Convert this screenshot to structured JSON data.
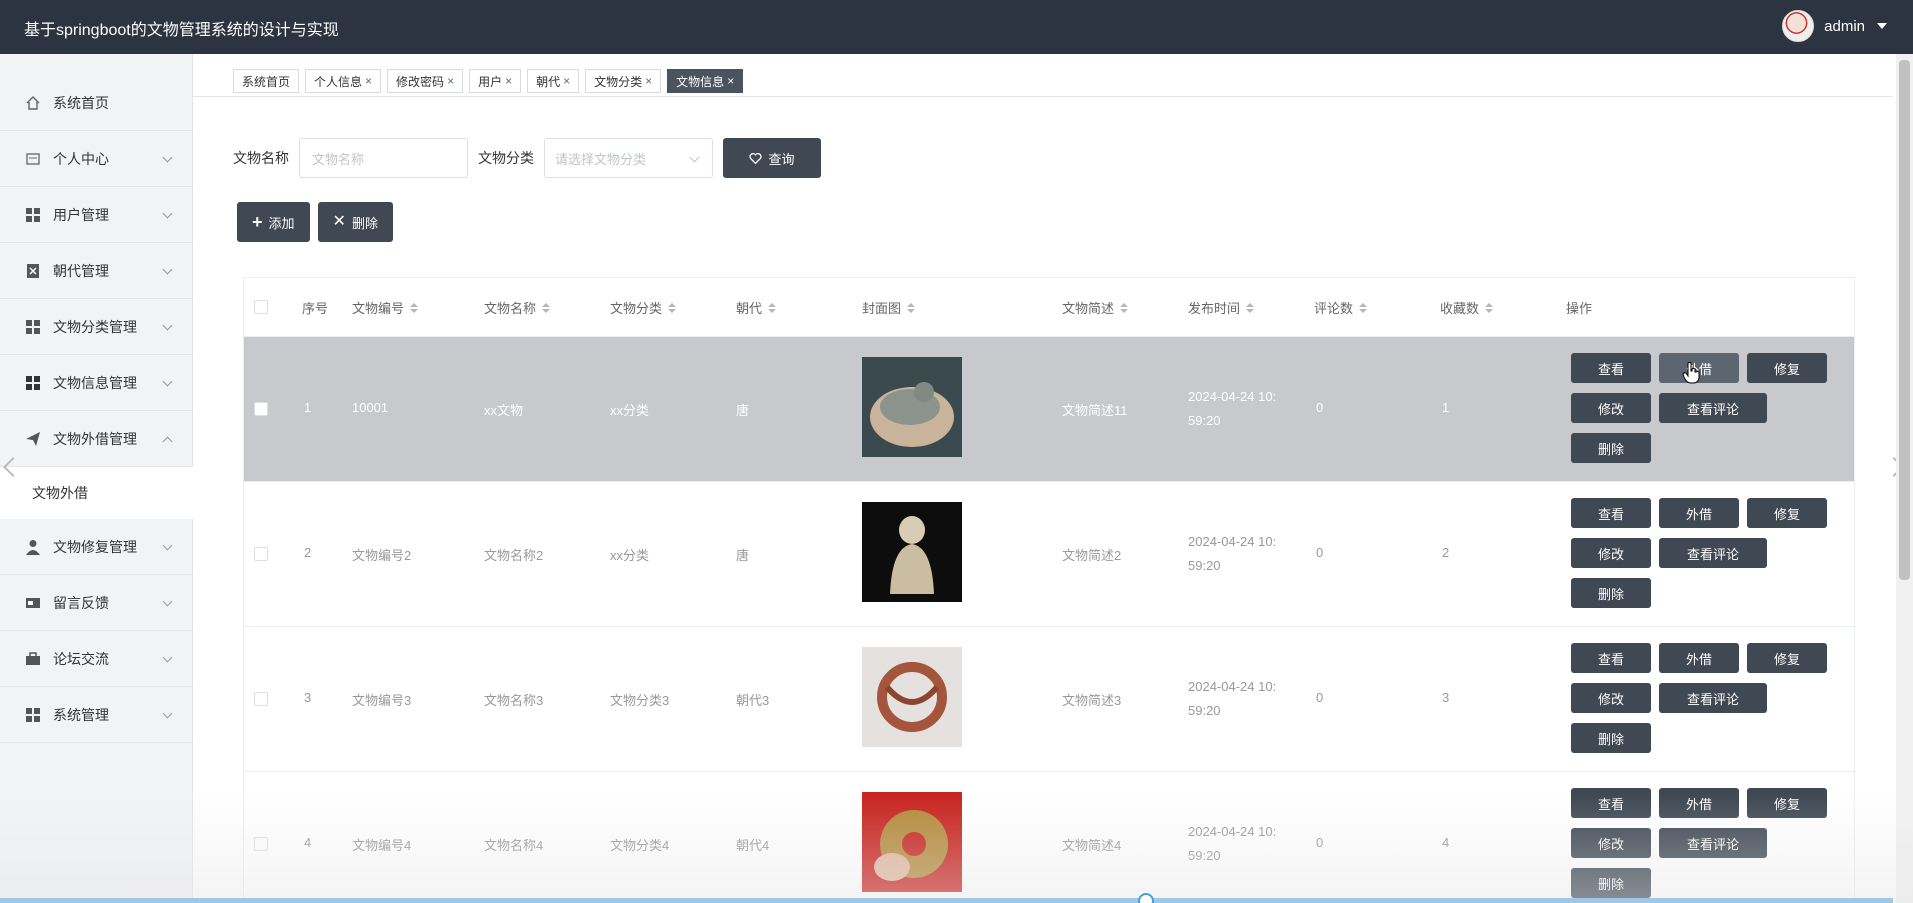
{
  "app": {
    "title": "基于springboot的文物管理系统的设计与实现",
    "user": "admin"
  },
  "sidebar": {
    "items": [
      {
        "label": "系统首页",
        "icon": "home-icon"
      },
      {
        "label": "个人中心",
        "icon": "id-card-icon"
      },
      {
        "label": "用户管理",
        "icon": "grid-icon"
      },
      {
        "label": "朝代管理",
        "icon": "document-x-icon"
      },
      {
        "label": "文物分类管理",
        "icon": "grid-icon"
      },
      {
        "label": "文物信息管理",
        "icon": "grid-icon"
      },
      {
        "label": "文物外借管理",
        "icon": "paper-plane-icon"
      },
      {
        "label": "文物修复管理",
        "icon": "user-icon"
      },
      {
        "label": "留言反馈",
        "icon": "card-icon"
      },
      {
        "label": "论坛交流",
        "icon": "briefcase-icon"
      },
      {
        "label": "系统管理",
        "icon": "grid-icon"
      }
    ],
    "submenu": "文物外借"
  },
  "tabs": [
    {
      "label": "系统首页",
      "closable": false
    },
    {
      "label": "个人信息",
      "closable": true
    },
    {
      "label": "修改密码",
      "closable": true
    },
    {
      "label": "用户",
      "closable": true
    },
    {
      "label": "朝代",
      "closable": true
    },
    {
      "label": "文物分类",
      "closable": true
    },
    {
      "label": "文物信息",
      "closable": true
    }
  ],
  "search": {
    "name_label": "文物名称",
    "name_placeholder": "文物名称",
    "category_label": "文物分类",
    "category_placeholder": "请选择文物分类",
    "query_label": "查询"
  },
  "actions": {
    "add_label": "添加",
    "delete_label": "删除"
  },
  "table": {
    "columns": [
      "序号",
      "文物编号",
      "文物名称",
      "文物分类",
      "朝代",
      "封面图",
      "文物简述",
      "发布时间",
      "评论数",
      "收藏数",
      "操作"
    ],
    "ops": {
      "view": "查看",
      "lend": "外借",
      "repair": "修复",
      "edit": "修改",
      "comments": "查看评论",
      "delete": "删除"
    },
    "rows": [
      {
        "idx": "1",
        "code": "10001",
        "name": "xx文物",
        "category": "xx分类",
        "dynasty": "唐",
        "desc": "文物简述11",
        "time1": "2024-04-24 10:",
        "time2": "59:20",
        "comments": "0",
        "favorites": "1"
      },
      {
        "idx": "2",
        "code": "文物编号2",
        "name": "文物名称2",
        "category": "xx分类",
        "dynasty": "唐",
        "desc": "文物简述2",
        "time1": "2024-04-24 10:",
        "time2": "59:20",
        "comments": "0",
        "favorites": "2"
      },
      {
        "idx": "3",
        "code": "文物编号3",
        "name": "文物名称3",
        "category": "文物分类3",
        "dynasty": "朝代3",
        "desc": "文物简述3",
        "time1": "2024-04-24 10:",
        "time2": "59:20",
        "comments": "0",
        "favorites": "3"
      },
      {
        "idx": "4",
        "code": "文物编号4",
        "name": "文物名称4",
        "category": "文物分类4",
        "dynasty": "朝代4",
        "desc": "文物简述4",
        "time1": "2024-04-24 10:",
        "time2": "59:20",
        "comments": "0",
        "favorites": "4"
      }
    ]
  }
}
